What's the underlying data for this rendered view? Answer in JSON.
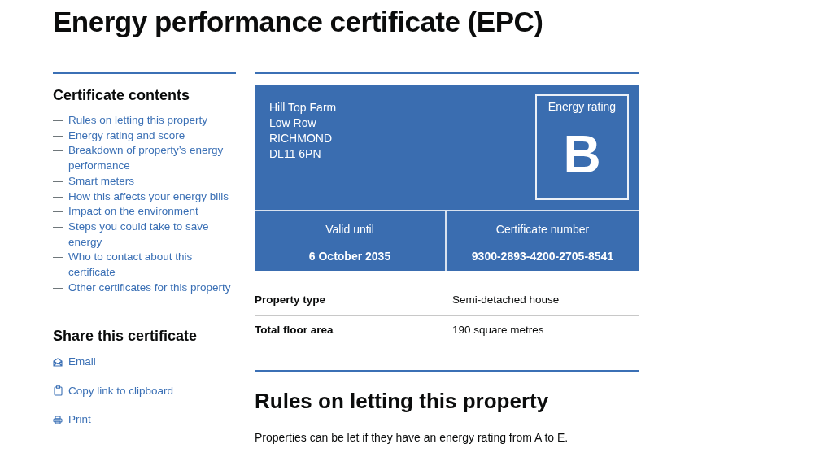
{
  "title": "Energy performance certificate (EPC)",
  "contents": {
    "heading": "Certificate contents",
    "items": [
      {
        "label": "Rules on letting this property"
      },
      {
        "label": "Energy rating and score"
      },
      {
        "label": "Breakdown of property’s energy performance"
      },
      {
        "label": "Smart meters"
      },
      {
        "label": "How this affects your energy bills"
      },
      {
        "label": "Impact on the environment"
      },
      {
        "label": "Steps you could take to save energy"
      },
      {
        "label": "Who to contact about this certificate"
      },
      {
        "label": "Other certificates for this property"
      }
    ]
  },
  "share": {
    "heading": "Share this certificate",
    "items": [
      {
        "kind": "email",
        "label": "Email"
      },
      {
        "kind": "copy",
        "label": "Copy link to clipboard"
      },
      {
        "kind": "print",
        "label": "Print"
      }
    ]
  },
  "certificate": {
    "address": [
      "Hill Top Farm",
      "Low Row",
      "RICHMOND",
      "DL11 6PN"
    ],
    "rating_label": "Energy rating",
    "rating": "B",
    "valid_label": "Valid until",
    "valid_value": "6 October 2035",
    "number_label": "Certificate number",
    "number_value": "9300-2893-4200-2705-8541"
  },
  "summary": [
    {
      "label": "Property type",
      "value": "Semi-detached house"
    },
    {
      "label": "Total floor area",
      "value": "190 square metres"
    }
  ],
  "section": {
    "heading": "Rules on letting this property",
    "text": "Properties can be let if they have an energy rating from A to E."
  }
}
